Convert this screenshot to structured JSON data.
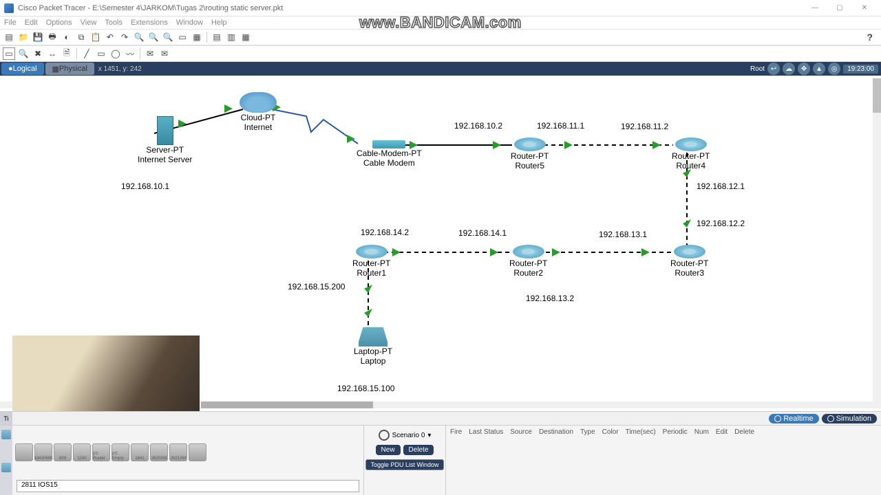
{
  "window": {
    "app": "Cisco Packet Tracer",
    "file": "E:\\Semester 4\\JARKOM\\Tugas 2\\routing static server.pkt",
    "watermark": "www.BANDICAM.com",
    "min": "—",
    "max": "▢",
    "close": "✕"
  },
  "menu": [
    "File",
    "Edit",
    "Options",
    "View",
    "Tools",
    "Extensions",
    "Window",
    "Help"
  ],
  "tabs": {
    "logical": "Logical",
    "physical": "Physical",
    "coords": "x 1451, y: 242",
    "root": "Root",
    "time": "19:23:00"
  },
  "mode": {
    "realtime": "Realtime",
    "simulation": "Simulation"
  },
  "devices": {
    "server": {
      "l1": "Server-PT",
      "l2": "Internet Server"
    },
    "cloud": {
      "l1": "Cloud-PT",
      "l2": "Internet"
    },
    "modem": {
      "l1": "Cable-Modem-PT",
      "l2": "Cable Modem"
    },
    "router5": {
      "l1": "Router-PT",
      "l2": "Router5"
    },
    "router4": {
      "l1": "Router-PT",
      "l2": "Router4"
    },
    "router3": {
      "l1": "Router-PT",
      "l2": "Router3"
    },
    "router2": {
      "l1": "Router-PT",
      "l2": "Router2"
    },
    "router1": {
      "l1": "Router-PT",
      "l2": "Router1"
    },
    "laptop": {
      "l1": "Laptop-PT",
      "l2": "Laptop"
    }
  },
  "ips": {
    "server": "192.168.10.1",
    "r5left": "192.168.10.2",
    "r5right": "192.168.11.1",
    "r4left": "192.168.11.2",
    "r4down": "192.168.12.1",
    "r3up": "192.168.12.2",
    "r3left": "192.168.13.1",
    "r2right": "192.168.13.2",
    "r2left": "192.168.14.1",
    "r1right": "192.168.14.2",
    "r1down": "192.168.15.200",
    "laptop": "192.168.15.100"
  },
  "bottom": {
    "scenario": "Scenario 0",
    "new": "New",
    "delete": "Delete",
    "toggle": "Toggle PDU List Window",
    "selected": "2811 IOS15",
    "chips": [
      "",
      "1941HWK",
      "829",
      "1240",
      "PT-Router",
      "PT-Empty",
      "1841",
      "2620XM",
      "2621XM",
      ""
    ],
    "pduHeaders": [
      "Fire",
      "Last Status",
      "Source",
      "Destination",
      "Type",
      "Color",
      "Time(sec)",
      "Periodic",
      "Num",
      "Edit",
      "Delete"
    ]
  }
}
